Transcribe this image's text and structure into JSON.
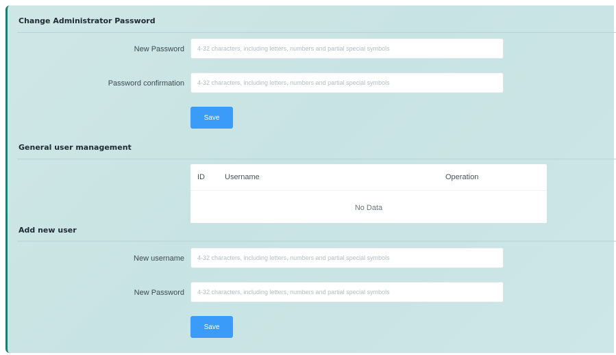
{
  "change_password": {
    "title": "Change Administrator Password",
    "new_password_label": "New Password",
    "confirm_label": "Password confirmation",
    "placeholder": "4-32 characters, including letters, numbers and partial special symbols",
    "new_password_value": "",
    "confirm_value": "",
    "save_label": "Save"
  },
  "user_management": {
    "title": "General user management",
    "columns": [
      "ID",
      "Username",
      "Operation"
    ],
    "rows": [],
    "empty_text": "No Data"
  },
  "add_user": {
    "title": "Add new user",
    "username_label": "New username",
    "password_label": "New Password",
    "placeholder": "4-32 characters, including letters, numbers and partial special symbols",
    "username_value": "",
    "password_value": "",
    "save_label": "Save"
  },
  "colors": {
    "panel_bg": "#c8e3e3",
    "accent_border": "#1f7a70",
    "primary_button": "#3a9cf8"
  }
}
